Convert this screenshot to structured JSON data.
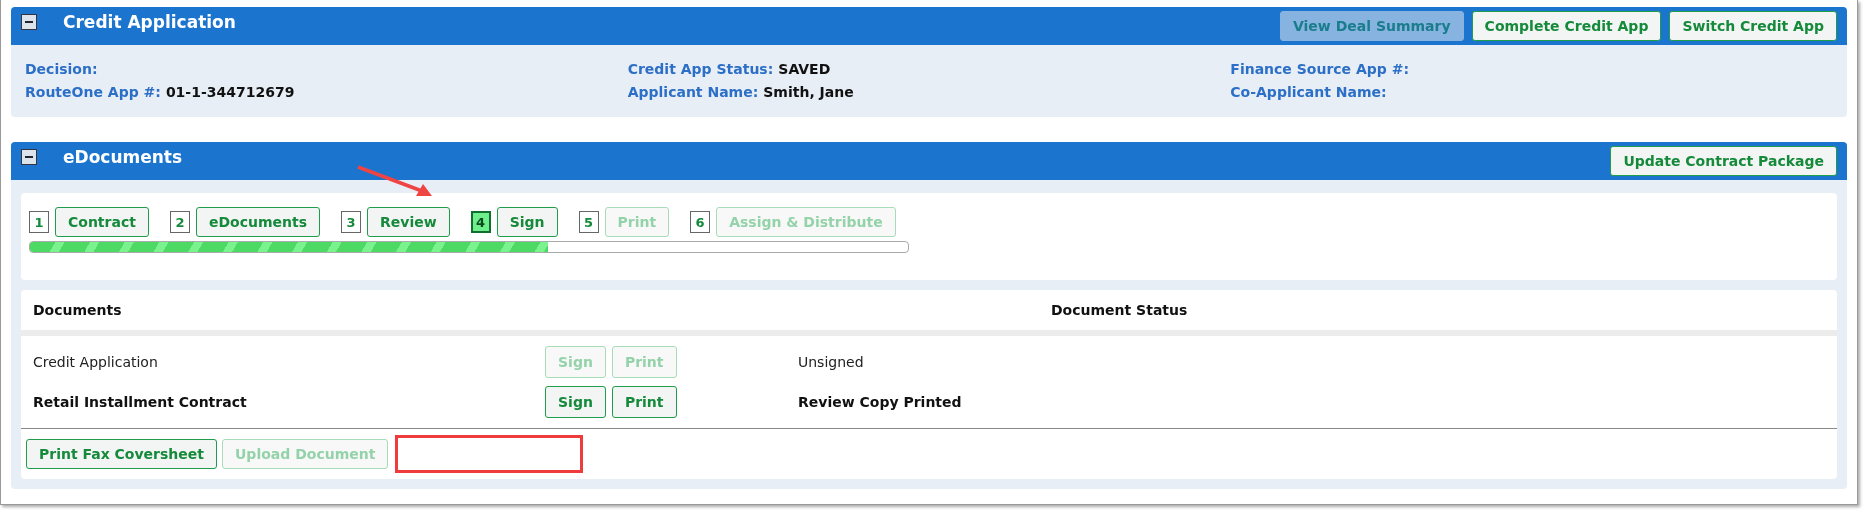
{
  "credit_application": {
    "title": "Credit Application",
    "buttons": [
      {
        "label": "View Deal Summary",
        "disabled": true
      },
      {
        "label": "Complete Credit App",
        "disabled": false
      },
      {
        "label": "Switch Credit App",
        "disabled": false
      }
    ],
    "fields": [
      {
        "label": "Decision:"
      },
      {
        "label": "Credit App Status:",
        "value": "SAVED"
      },
      {
        "label": "Finance Source App #:"
      },
      {
        "label": "RouteOne App #:",
        "value": "01-1-344712679"
      },
      {
        "label": "Applicant Name:",
        "value": "Smith, Jane"
      },
      {
        "label": "Co-Applicant Name:"
      }
    ]
  },
  "edocuments": {
    "title": "eDocuments",
    "button": "Update Contract Package",
    "steps": [
      {
        "number": "1",
        "label": "Contract",
        "current": false,
        "disabled": false
      },
      {
        "number": "2",
        "label": "eDocuments",
        "current": false,
        "disabled": false
      },
      {
        "number": "3",
        "label": "Review",
        "current": false,
        "disabled": false
      },
      {
        "number": "4",
        "label": "Sign",
        "current": true,
        "disabled": false
      },
      {
        "number": "5",
        "label": "Print",
        "current": false,
        "disabled": true
      },
      {
        "number": "6",
        "label": "Assign & Distribute",
        "current": false,
        "disabled": true
      }
    ],
    "progress": {
      "level": 0.59
    },
    "table": {
      "columns": [
        "Documents",
        "Document Status"
      ],
      "rows": [
        {
          "name": "Credit Application",
          "emphasized": false,
          "actions": [
            {
              "label": "Sign",
              "disabled": true
            },
            {
              "label": "Print",
              "disabled": true
            }
          ],
          "status": "Unsigned"
        },
        {
          "name": "Retail Installment Contract",
          "emphasized": true,
          "actions": [
            {
              "label": "Sign",
              "disabled": false
            },
            {
              "label": "Print",
              "disabled": false
            }
          ],
          "status": "Review Copy Printed"
        }
      ]
    },
    "footer_buttons": [
      {
        "label": "Print Fax Coversheet",
        "disabled": false
      },
      {
        "label": "Upload Document",
        "disabled": true
      }
    ]
  }
}
